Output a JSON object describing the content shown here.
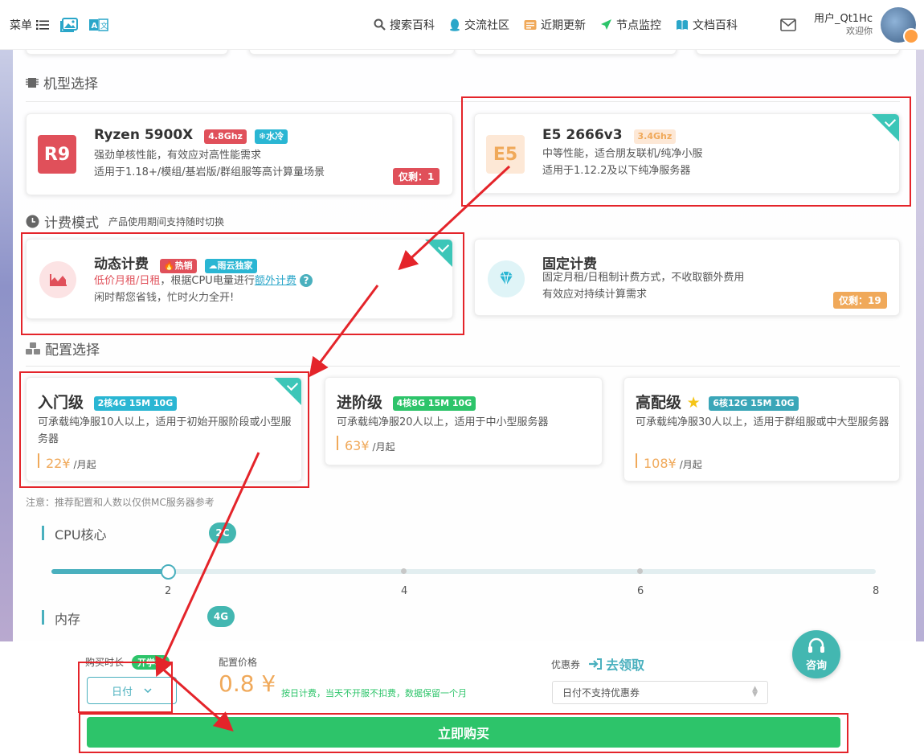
{
  "topbar": {
    "menu_label": "菜单",
    "nav": [
      {
        "label": "搜索百科",
        "icon": "search-icon"
      },
      {
        "label": "交流社区",
        "icon": "qq-icon"
      },
      {
        "label": "近期更新",
        "icon": "news-icon"
      },
      {
        "label": "节点监控",
        "icon": "send-icon"
      },
      {
        "label": "文档百科",
        "icon": "book-icon"
      }
    ],
    "user_name": "用户_Qt1Hc",
    "welcome": "欢迎你"
  },
  "model_section": {
    "title": "机型选择",
    "cards": [
      {
        "chip": "R9",
        "name": "Ryzen 5900X",
        "freq": "4.8Ghz",
        "cooling": "水冷",
        "desc1": "强劲单核性能，有效应对高性能需求",
        "desc2": "适用于1.18+/模组/基岩版/群组服等高计算量场景",
        "remain": "仅剩：1",
        "selected": false
      },
      {
        "chip": "E5",
        "name": "E5 2666v3",
        "freq": "3.4Ghz",
        "desc1": "中等性能，适合朋友联机/纯净小服",
        "desc2": "适用于1.12.2及以下纯净服务器",
        "selected": true
      }
    ]
  },
  "billing_section": {
    "title": "计费模式",
    "subtitle": "产品使用期间支持随时切换",
    "cards": [
      {
        "name": "动态计费",
        "tag_hot": "热销",
        "tag_excl": "雨云独家",
        "desc1_red": "低价月租/日租",
        "desc1_rest": "，根据CPU电量进行",
        "desc1_link": "额外计费",
        "desc2": "闲时帮您省钱，忙时火力全开!",
        "selected": true
      },
      {
        "name": "固定计费",
        "desc1": "固定月租/日租制计费方式，不收取额外费用",
        "desc2": "有效应对持续计算需求",
        "remain": "仅剩：19",
        "selected": false
      }
    ]
  },
  "config_section": {
    "title": "配置选择",
    "cards": [
      {
        "name": "入门级",
        "spec": "2核4G 15M 10G",
        "desc": "可承载纯净服10人以上，适用于初始开服阶段或小型服务器",
        "price": "22¥",
        "unit": "/月起",
        "selected": true
      },
      {
        "name": "进阶级",
        "spec": "4核8G 15M 10G",
        "desc": "可承载纯净服20人以上，适用于中小型服务器",
        "price": "63¥",
        "unit": "/月起",
        "selected": false
      },
      {
        "name": "高配级",
        "spec": "6核12G 15M 10G",
        "desc": "可承载纯净服30人以上，适用于群组服或中大型服务器",
        "price": "108¥",
        "unit": "/月起",
        "selected": false
      }
    ],
    "note": "注意：推荐配置和人数以仅供MC服务器参考"
  },
  "cpu": {
    "label": "CPU核心",
    "value": "2C",
    "ticks": [
      "2",
      "4",
      "6",
      "8"
    ],
    "selected_fraction": 0.0
  },
  "memory": {
    "label": "内存",
    "value": "4G"
  },
  "purchase": {
    "duration_label": "购买时长",
    "duration_tag": "开学季",
    "duration_value": "日付",
    "price_label": "配置价格",
    "price": "0.8 ¥",
    "price_hint": "按日计费，当天不开服不扣费，数据保留一个月",
    "coupon_label": "优惠券",
    "coupon_link": "去领取",
    "coupon_select": "日付不支持优惠券",
    "buy_button": "立即购买",
    "consult": "咨询"
  },
  "colors": {
    "accent": "#43b7b1",
    "green": "#2dc46a",
    "orange": "#f0a95a",
    "red": "#e0505a",
    "annotation": "#e4242a"
  }
}
